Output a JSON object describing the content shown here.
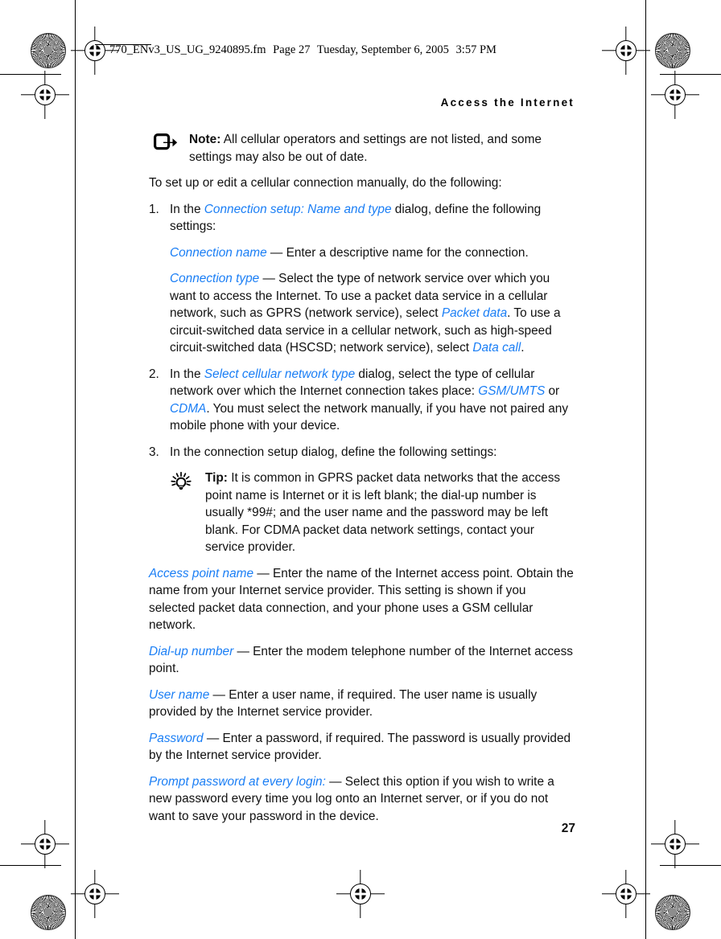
{
  "slug": {
    "filename": "770_ENv3_US_UG_9240895.fm",
    "page_label": "Page 27",
    "date": "Tuesday, September 6, 2005",
    "time": "3:57 PM"
  },
  "running_head": "Access the Internet",
  "folio": "27",
  "colors": {
    "ui_reference_blue": "#1a7ef5",
    "body_text": "#111111",
    "page_background": "#ffffff"
  },
  "note": {
    "icon": "note-arrow-icon",
    "label": "Note:",
    "text": " All cellular operators and settings are not listed, and some settings may also be out of date."
  },
  "intro": "To set up or edit a cellular connection manually, do the following:",
  "steps": [
    {
      "number": "1.",
      "lead_a": "In the ",
      "ui_1": "Connection setup: Name and type",
      "lead_b": " dialog, define the following settings:"
    },
    {
      "number": "2.",
      "lead_a": "In the ",
      "ui_1": "Select cellular network type",
      "lead_b": " dialog, select the type of cellular network over which the Internet connection takes place: ",
      "ui_2": "GSM/UMTS",
      "mid": " or ",
      "ui_3": "CDMA",
      "tail": ". You must select the network manually, if you have not paired any mobile phone with your device."
    },
    {
      "number": "3.",
      "lead_a": "In the connection setup dialog, define the following settings:"
    }
  ],
  "step1_settings": [
    {
      "term": "Connection name",
      "body": " — Enter a descriptive name for the connection."
    },
    {
      "term": "Connection type",
      "body_a": " — Select the type of network service over which you want to access the Internet. To use a packet data service in a cellular network, such as GPRS (network service), select ",
      "ui_inline_1": "Packet data",
      "body_b": ". To use a circuit-switched data service in a cellular network, such as high-speed circuit-switched data (HSCSD; network service), select ",
      "ui_inline_2": "Data call",
      "body_c": "."
    }
  ],
  "tip": {
    "icon": "lightbulb-icon",
    "label": "Tip:",
    "text": " It is common in GPRS packet data networks that the access point name is Internet or it is left blank; the dial-up number is usually *99#; and the user name and the password may be left blank. For CDMA packet data network settings, contact your service provider."
  },
  "step3_settings": [
    {
      "term": "Access point name",
      "body": " — Enter the name of the Internet access point. Obtain the name from your Internet service provider. This setting is shown if you selected packet data connection, and your phone uses a GSM cellular network."
    },
    {
      "term": "Dial-up number",
      "body": " — Enter the modem telephone number of the Internet access point."
    },
    {
      "term": "User name",
      "body": " — Enter a user name, if required. The user name is usually provided by the Internet service provider."
    },
    {
      "term": "Password",
      "body": " — Enter a password, if required. The password is usually provided by the Internet service provider."
    },
    {
      "term": "Prompt password at every login:",
      "body": " — Select this option if you wish to write a new password every time you log onto an Internet server, or if you do not want to save your password in the device."
    }
  ]
}
